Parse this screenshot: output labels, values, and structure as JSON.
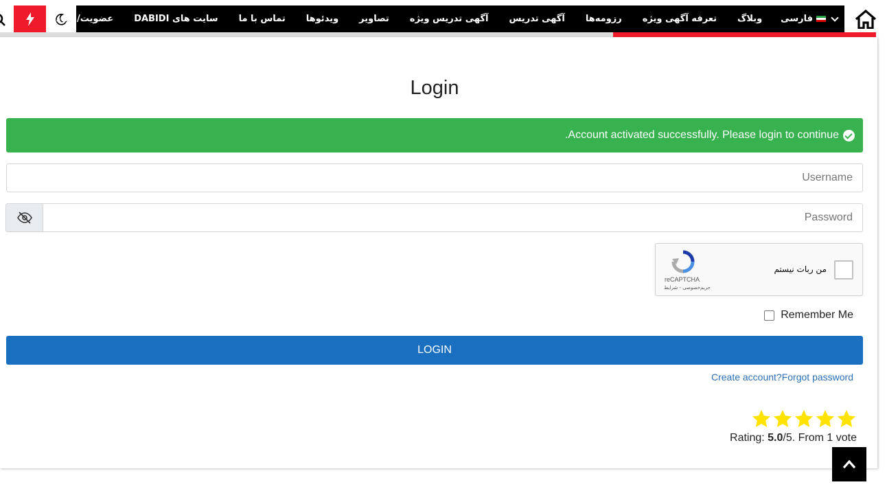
{
  "nav": {
    "items": [
      {
        "label": "فارسی"
      },
      {
        "label": "وبلاگ"
      },
      {
        "label": "تعرفه آگهی ویژه"
      },
      {
        "label": "رزومه‌ها"
      },
      {
        "label": "آگهی تدریس"
      },
      {
        "label": "آگهی تدریس ویژه"
      },
      {
        "label": "تصاویر"
      },
      {
        "label": "ویدئوها"
      },
      {
        "label": "تماس با ما"
      },
      {
        "label": "سایت های DABIDI"
      },
      {
        "label": "عضویت/ورود"
      }
    ],
    "reading_progress": 0.3,
    "colors": {
      "bar": "#000000",
      "accent": "#ef1b2a"
    }
  },
  "login": {
    "title": "Login",
    "alert": "Account activated successfully. Please login to continue.",
    "username_placeholder": "Username",
    "password_placeholder": "Password",
    "remember_label": "Remember Me",
    "login_button": "LOGIN",
    "create_account": "Create account?",
    "forgot_password": "Forgot password",
    "colors": {
      "success": "#38b24f",
      "primary": "#1a6fc0",
      "link": "#2a6fb7"
    }
  },
  "captcha": {
    "label": "من ربات نیستم",
    "brand": "reCAPTCHA",
    "terms": "حریم‌خصوصی - شرایط"
  },
  "rating": {
    "stars": 5,
    "prefix": "Rating: ",
    "score": "5.0",
    "suffix": "/5. From 1 vote",
    "star_color": "#ffe300"
  }
}
